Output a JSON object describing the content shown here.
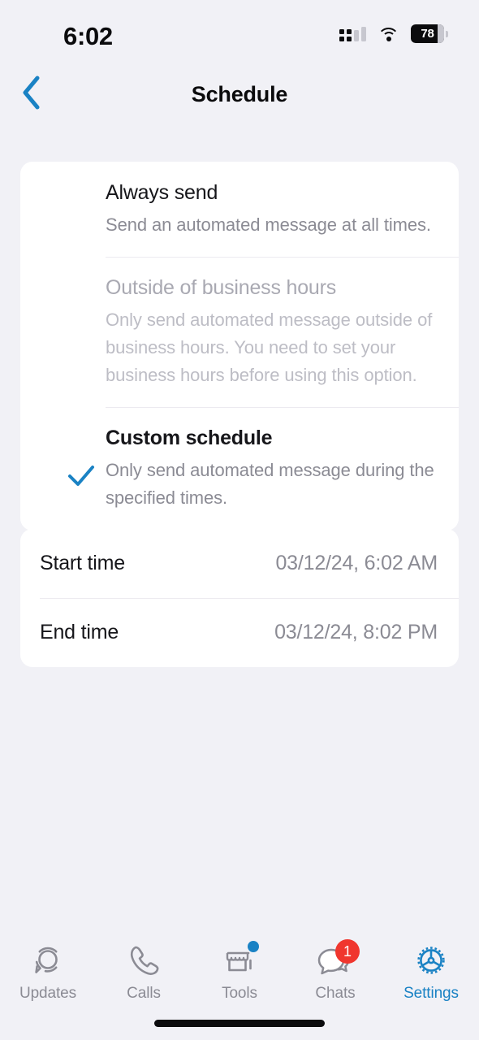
{
  "status_bar": {
    "time": "6:02",
    "signal_icon": "cellular-signal-icon",
    "wifi_icon": "wifi-icon",
    "battery_level": "78",
    "battery_icon": "battery-icon"
  },
  "nav": {
    "back_icon": "chevron-left-icon",
    "title": "Schedule",
    "accent_color": "#1a82c4"
  },
  "options": [
    {
      "title": "Always send",
      "description": "Send an automated message at all times.",
      "selected": false,
      "disabled": false
    },
    {
      "title": "Outside of business hours",
      "description": "Only send automated message outside of business hours. You need to set your business hours before using this option.",
      "selected": false,
      "disabled": true
    },
    {
      "title": "Custom schedule",
      "description": "Only send automated message during the specified times.",
      "selected": true,
      "disabled": false,
      "check_icon": "checkmark-icon"
    }
  ],
  "times": [
    {
      "label": "Start time",
      "value": "03/12/24, 6:02 AM"
    },
    {
      "label": "End time",
      "value": "03/12/24, 8:02 PM"
    }
  ],
  "tabs": [
    {
      "label": "Updates",
      "icon": "status-rings-icon",
      "active": false,
      "badge": null,
      "dot": false
    },
    {
      "label": "Calls",
      "icon": "phone-icon",
      "active": false,
      "badge": null,
      "dot": false
    },
    {
      "label": "Tools",
      "icon": "storefront-icon",
      "active": false,
      "badge": null,
      "dot": true
    },
    {
      "label": "Chats",
      "icon": "speech-bubbles-icon",
      "active": false,
      "badge": "1",
      "dot": false
    },
    {
      "label": "Settings",
      "icon": "gear-icon",
      "active": true,
      "badge": null,
      "dot": false
    }
  ],
  "colors": {
    "background": "#f1f1f6",
    "card": "#ffffff",
    "accent": "#1a82c4",
    "badge": "#f0362e",
    "muted_text": "#8b8b94",
    "disabled_text": "#bdbdc5"
  }
}
